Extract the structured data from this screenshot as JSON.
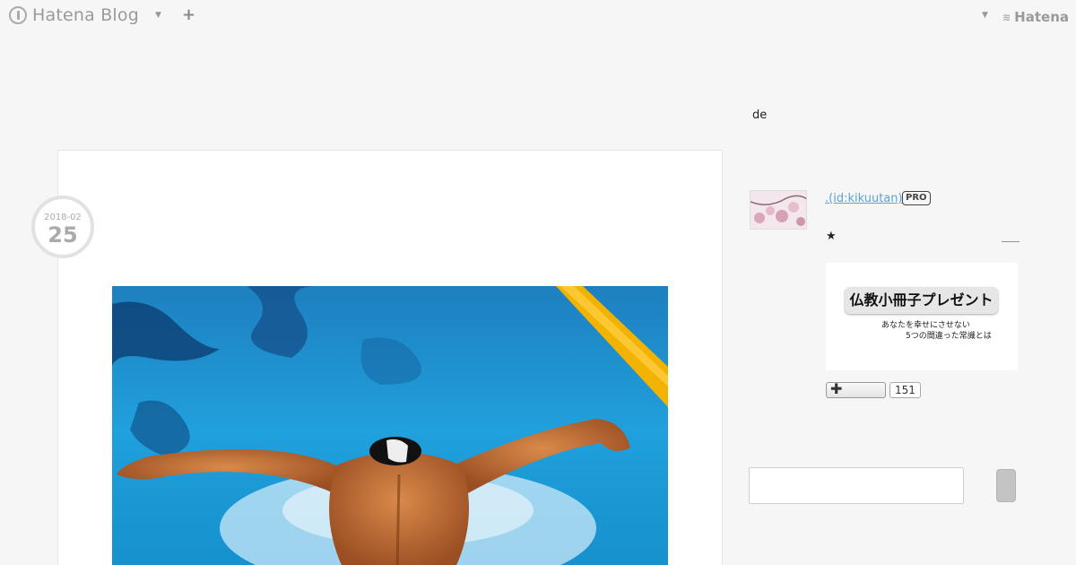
{
  "topbar": {
    "logo_text": "Hatena Blog",
    "logo_icon": "hatena-blog-logo-icon",
    "caret_icon": "caret-down-icon",
    "plus_icon": "plus-icon",
    "right_brand": "Hatena"
  },
  "header": {
    "blurb": "de"
  },
  "article": {
    "date_ym": "2018-02",
    "date_day": "25",
    "photo_subject": "swimmer-butterfly-image"
  },
  "sidebar": {
    "author_link": ".(id:kikuutan)",
    "pro_badge": "PRO",
    "star": "★",
    "banner": {
      "title": "仏教小冊子プレゼント",
      "line1": "あなたを幸せにさせない",
      "line2": "5つの間違った常識とは"
    },
    "follow": {
      "plus": "✚",
      "count": "151"
    }
  },
  "colors": {
    "link": "#5aa4cf",
    "water": "#1b8fd0",
    "lane": "#f0b400"
  }
}
